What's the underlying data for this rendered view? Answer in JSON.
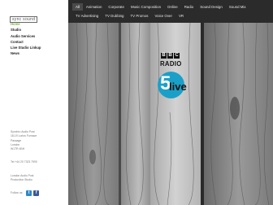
{
  "logo": {
    "text": "sync sound"
  },
  "nav": {
    "items": [
      {
        "label": "Home",
        "active": true
      },
      {
        "label": "Studio",
        "active": false
      },
      {
        "label": "Audio Services",
        "active": false
      },
      {
        "label": "Contact",
        "active": false
      },
      {
        "label": "Live Studio Linkup",
        "active": false
      },
      {
        "label": "News",
        "active": false
      }
    ]
  },
  "address": {
    "lines": [
      "Synchro Audio Post",
      "18-19 Lorlos Furnace",
      "Passage",
      "London",
      "W1TR 4BH"
    ]
  },
  "tel": "Tel +44 20 7323 7590",
  "studio_links": {
    "lines": [
      "London Audio Post",
      "Production Studio"
    ]
  },
  "follow": {
    "label": "Follow us:",
    "twitter": "t",
    "facebook": "f"
  },
  "tags": {
    "row1": [
      "All",
      "Animation",
      "Corporate",
      "Music Composition",
      "Online",
      "Radio",
      "Sound Design",
      "Sound Mix"
    ],
    "row2": [
      "TV Advertising",
      "TV Dubbing",
      "TV Promos",
      "Voice Over",
      "VR"
    ]
  },
  "hero": {
    "bbc_letters": [
      "B",
      "B",
      "C"
    ],
    "radio_word": "RADIO",
    "five": "5",
    "live": "live",
    "badge_color": "#1aa0c8"
  },
  "colors": {
    "accent_green": "#7ab342",
    "menu_bg": "#2b2b2b",
    "twitter": "#2f87c8",
    "facebook": "#3b5a98"
  }
}
